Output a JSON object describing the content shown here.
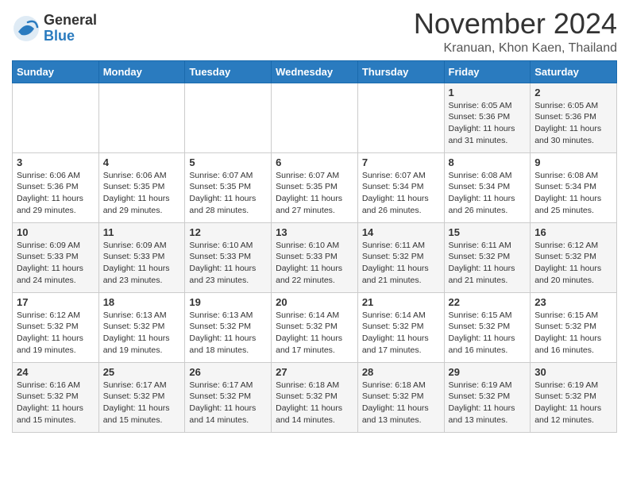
{
  "logo": {
    "general": "General",
    "blue": "Blue"
  },
  "title": "November 2024",
  "location": "Kranuan, Khon Kaen, Thailand",
  "days_of_week": [
    "Sunday",
    "Monday",
    "Tuesday",
    "Wednesday",
    "Thursday",
    "Friday",
    "Saturday"
  ],
  "weeks": [
    {
      "days": [
        {
          "num": "",
          "info": ""
        },
        {
          "num": "",
          "info": ""
        },
        {
          "num": "",
          "info": ""
        },
        {
          "num": "",
          "info": ""
        },
        {
          "num": "",
          "info": ""
        },
        {
          "num": "1",
          "info": "Sunrise: 6:05 AM\nSunset: 5:36 PM\nDaylight: 11 hours\nand 31 minutes."
        },
        {
          "num": "2",
          "info": "Sunrise: 6:05 AM\nSunset: 5:36 PM\nDaylight: 11 hours\nand 30 minutes."
        }
      ]
    },
    {
      "days": [
        {
          "num": "3",
          "info": "Sunrise: 6:06 AM\nSunset: 5:36 PM\nDaylight: 11 hours\nand 29 minutes."
        },
        {
          "num": "4",
          "info": "Sunrise: 6:06 AM\nSunset: 5:35 PM\nDaylight: 11 hours\nand 29 minutes."
        },
        {
          "num": "5",
          "info": "Sunrise: 6:07 AM\nSunset: 5:35 PM\nDaylight: 11 hours\nand 28 minutes."
        },
        {
          "num": "6",
          "info": "Sunrise: 6:07 AM\nSunset: 5:35 PM\nDaylight: 11 hours\nand 27 minutes."
        },
        {
          "num": "7",
          "info": "Sunrise: 6:07 AM\nSunset: 5:34 PM\nDaylight: 11 hours\nand 26 minutes."
        },
        {
          "num": "8",
          "info": "Sunrise: 6:08 AM\nSunset: 5:34 PM\nDaylight: 11 hours\nand 26 minutes."
        },
        {
          "num": "9",
          "info": "Sunrise: 6:08 AM\nSunset: 5:34 PM\nDaylight: 11 hours\nand 25 minutes."
        }
      ]
    },
    {
      "days": [
        {
          "num": "10",
          "info": "Sunrise: 6:09 AM\nSunset: 5:33 PM\nDaylight: 11 hours\nand 24 minutes."
        },
        {
          "num": "11",
          "info": "Sunrise: 6:09 AM\nSunset: 5:33 PM\nDaylight: 11 hours\nand 23 minutes."
        },
        {
          "num": "12",
          "info": "Sunrise: 6:10 AM\nSunset: 5:33 PM\nDaylight: 11 hours\nand 23 minutes."
        },
        {
          "num": "13",
          "info": "Sunrise: 6:10 AM\nSunset: 5:33 PM\nDaylight: 11 hours\nand 22 minutes."
        },
        {
          "num": "14",
          "info": "Sunrise: 6:11 AM\nSunset: 5:32 PM\nDaylight: 11 hours\nand 21 minutes."
        },
        {
          "num": "15",
          "info": "Sunrise: 6:11 AM\nSunset: 5:32 PM\nDaylight: 11 hours\nand 21 minutes."
        },
        {
          "num": "16",
          "info": "Sunrise: 6:12 AM\nSunset: 5:32 PM\nDaylight: 11 hours\nand 20 minutes."
        }
      ]
    },
    {
      "days": [
        {
          "num": "17",
          "info": "Sunrise: 6:12 AM\nSunset: 5:32 PM\nDaylight: 11 hours\nand 19 minutes."
        },
        {
          "num": "18",
          "info": "Sunrise: 6:13 AM\nSunset: 5:32 PM\nDaylight: 11 hours\nand 19 minutes."
        },
        {
          "num": "19",
          "info": "Sunrise: 6:13 AM\nSunset: 5:32 PM\nDaylight: 11 hours\nand 18 minutes."
        },
        {
          "num": "20",
          "info": "Sunrise: 6:14 AM\nSunset: 5:32 PM\nDaylight: 11 hours\nand 17 minutes."
        },
        {
          "num": "21",
          "info": "Sunrise: 6:14 AM\nSunset: 5:32 PM\nDaylight: 11 hours\nand 17 minutes."
        },
        {
          "num": "22",
          "info": "Sunrise: 6:15 AM\nSunset: 5:32 PM\nDaylight: 11 hours\nand 16 minutes."
        },
        {
          "num": "23",
          "info": "Sunrise: 6:15 AM\nSunset: 5:32 PM\nDaylight: 11 hours\nand 16 minutes."
        }
      ]
    },
    {
      "days": [
        {
          "num": "24",
          "info": "Sunrise: 6:16 AM\nSunset: 5:32 PM\nDaylight: 11 hours\nand 15 minutes."
        },
        {
          "num": "25",
          "info": "Sunrise: 6:17 AM\nSunset: 5:32 PM\nDaylight: 11 hours\nand 15 minutes."
        },
        {
          "num": "26",
          "info": "Sunrise: 6:17 AM\nSunset: 5:32 PM\nDaylight: 11 hours\nand 14 minutes."
        },
        {
          "num": "27",
          "info": "Sunrise: 6:18 AM\nSunset: 5:32 PM\nDaylight: 11 hours\nand 14 minutes."
        },
        {
          "num": "28",
          "info": "Sunrise: 6:18 AM\nSunset: 5:32 PM\nDaylight: 11 hours\nand 13 minutes."
        },
        {
          "num": "29",
          "info": "Sunrise: 6:19 AM\nSunset: 5:32 PM\nDaylight: 11 hours\nand 13 minutes."
        },
        {
          "num": "30",
          "info": "Sunrise: 6:19 AM\nSunset: 5:32 PM\nDaylight: 11 hours\nand 12 minutes."
        }
      ]
    }
  ]
}
